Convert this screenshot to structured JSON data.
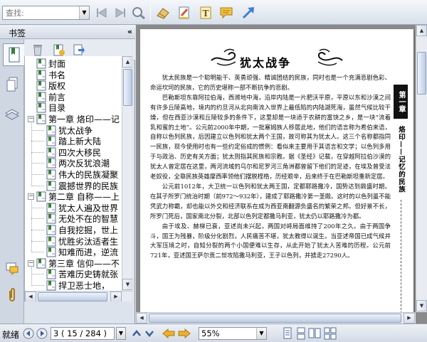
{
  "toolbar": {
    "search_placeholder": "查找:",
    "icons": [
      "prev-result-icon",
      "next-result-icon",
      "find-icon",
      "eraser-tool-icon",
      "highlight-pen-icon",
      "text-tool-icon",
      "note-icon",
      "arrow-tool-icon"
    ]
  },
  "left_panel": {
    "title": "书签",
    "collapse_glyph": "«",
    "side_tabs": [
      "bookmarks-tab-icon",
      "pages-tab-icon",
      "layers-tab-icon",
      "comments-tab-icon",
      "attachments-tab-icon"
    ],
    "bookmark_tools": [
      "delete-bookmark-icon",
      "add-bookmark-icon",
      "go-to-bookmark-icon"
    ],
    "bookmarks": [
      {
        "label": "封面",
        "level": 0
      },
      {
        "label": "书名",
        "level": 0
      },
      {
        "label": "版权",
        "level": 0
      },
      {
        "label": "前言",
        "level": 0
      },
      {
        "label": "目录",
        "level": 0
      },
      {
        "label": "第一章  烙印——记",
        "level": 0,
        "expanded": true
      },
      {
        "label": "犹太战争",
        "level": 1
      },
      {
        "label": "踏上新大陆",
        "level": 1
      },
      {
        "label": "四次大移民",
        "level": 1
      },
      {
        "label": "两次反犹浪潮",
        "level": 1
      },
      {
        "label": "伟大的民族凝聚",
        "level": 1
      },
      {
        "label": "震撼世界的民族",
        "level": 1
      },
      {
        "label": "第二章  自称——上",
        "level": 0,
        "expanded": true
      },
      {
        "label": "犹太人遍及世界",
        "level": 1
      },
      {
        "label": "无处不在的智慧",
        "level": 1
      },
      {
        "label": "自我挖掘，世上",
        "level": 1
      },
      {
        "label": "忧胜劣汰适者生",
        "level": 1
      },
      {
        "label": "知难而进，逆流",
        "level": 1
      },
      {
        "label": "第三章  信仰——不",
        "level": 0,
        "expanded": true
      },
      {
        "label": "苦难历史铸就张",
        "level": 1
      },
      {
        "label": "捍卫恶士地，",
        "level": 1
      }
    ]
  },
  "document": {
    "title": "犹太战争",
    "chapter_tab": "第一章",
    "chapter_side": "烙印——记忆的民族",
    "paragraphs": [
      "犹太民族是一个聪明能干、英勇顽强、精诚团结的民族，同时也是一个充满悲剧色彩、命运坎坷的民族，它的历史堪称一部不断抗争的悲剧。",
      "巴勒斯坦东靠阿拉伯海，西濒地中海，沿岸内陆是一片肥沃平原，平原以东和沙漠之间有许多丘陵高地，境内的约旦河从北向南流入世界上最低陷的内陆湖死海，虽然气候比较干燥，但在西亚沙漠和丘陵较多的条件下，这里却是一块适于农耕的富饶之乡，是一块“流着乳和蜜的土地”。公元前2000年中期，一批塞姆族人移居此地，他们的语言称为希伯来语，自称以色列民族，后因建立以色列和犹太两个王国，故可称其为犹太人。这三个名称都指同一民族，现今使用时也有一些约定俗成的惯例：看似来主要用于其语言和文学；以色列多用于与政治、历史有关方面；犹太则指其民族和宗教。据《圣经》记载，在穿越阿拉伯沙漠的犹太人曾定居在这里，两河流域的乌尔和尼罗河三角洲都曾留下他们的足迹，在埃及曾受法老奴役，全靠民族英雄摩西率领他们摆脱桎梏，历经艰辛，后来终于在巴勒斯坦重新定居。",
      "公元前1012年，大卫统一以色列和犹太两王国，定都耶路撒冷，国势达到鼎盛时期。在其子所罗门统治时期（前972～932年），建成了耶路撒冷第一圣殿。这时的以色列虽不能凭武力称霸，却也能以外交和经济联系在成为西亚南翻源负盛名的繁荣之邦。但好景不长，所罗门死后，国家南北分裂，北部以色列定都撒马利亚，犹太仍以耶路撒冷为都。",
      "由于埃及、赫梯已衰，亚述尚未兴起，两国对峙局面维持了200年之久。由于两国争斗，国王为残暴，阶级分化剧烈，人民痛苦不堪，犹太教得以诞生。当亚述帝国已成气候并大军压境之时，自知分裂的两个小国便难以生存，从此开始了犹太人苦难的历程。公元前721年，亚述国王萨尔贡二世攻陷撒马利亚，王子以色列，并掳走27290人。"
    ]
  },
  "statusbar": {
    "status": "就绪",
    "page_value": "3 ( 15 / 284 )",
    "zoom_value": "55%"
  }
}
